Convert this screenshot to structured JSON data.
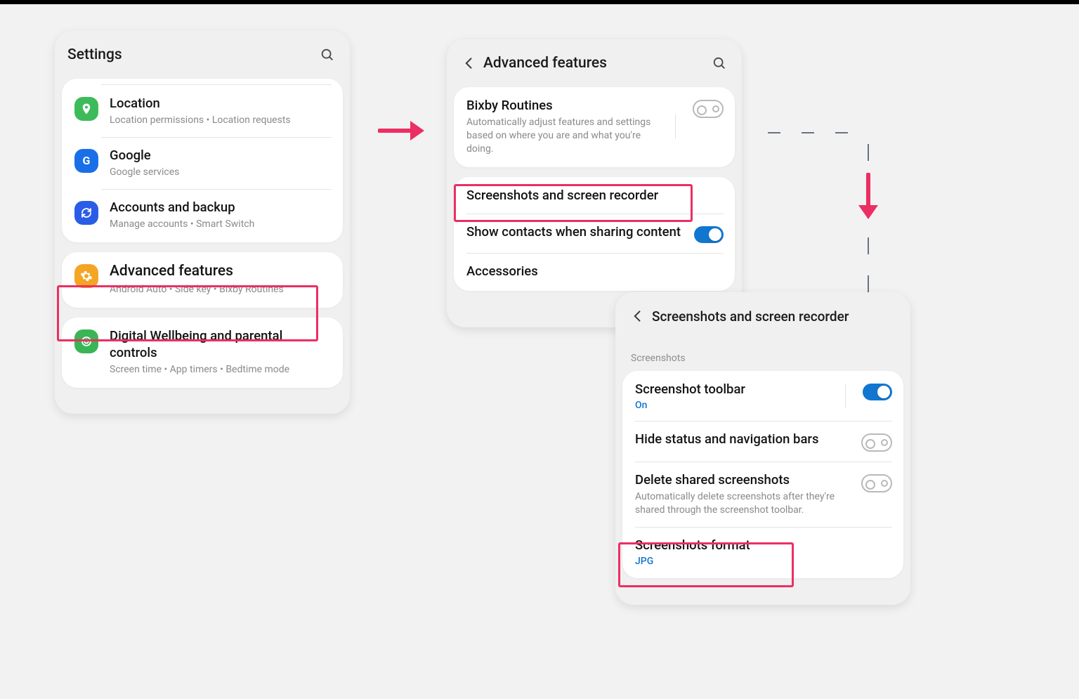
{
  "screen1": {
    "title": "Settings",
    "items": [
      {
        "icon": "location",
        "color": "#3dbb5a",
        "title": "Location",
        "sub": "Location permissions  •  Location requests"
      },
      {
        "icon": "google",
        "color": "#1a6fe8",
        "title": "Google",
        "sub": "Google services"
      },
      {
        "icon": "sync",
        "color": "#2a5de6",
        "title": "Accounts and backup",
        "sub": "Manage accounts  •  Smart Switch"
      },
      {
        "icon": "gear",
        "color": "#f5a524",
        "title": "Advanced features",
        "sub": "Android Auto  •  Side key  •  Bixby Routines"
      },
      {
        "icon": "wellbeing",
        "color": "#39b556",
        "title": "Digital Wellbeing and parental controls",
        "sub": "Screen time  •  App timers  •  Bedtime mode"
      }
    ]
  },
  "screen2": {
    "title": "Advanced features",
    "bixby": {
      "title": "Bixby Routines",
      "sub": "Automatically adjust features and settings based on where you are and what you're doing."
    },
    "screenshots_label": "Screenshots and screen recorder",
    "contacts_label": "Show contacts when sharing content",
    "accessories_label": "Accessories"
  },
  "screen3": {
    "title": "Screenshots and screen recorder",
    "section": "Screenshots",
    "toolbar": {
      "title": "Screenshot toolbar",
      "status": "On"
    },
    "hidebars_label": "Hide status and navigation bars",
    "delete": {
      "title": "Delete shared screenshots",
      "sub": "Automatically delete screenshots after they're shared through the screenshot toolbar."
    },
    "format": {
      "title": "Screenshots format",
      "value": "JPG"
    }
  },
  "colors": {
    "accent": "#eb2f62",
    "blue": "#1176d0"
  }
}
